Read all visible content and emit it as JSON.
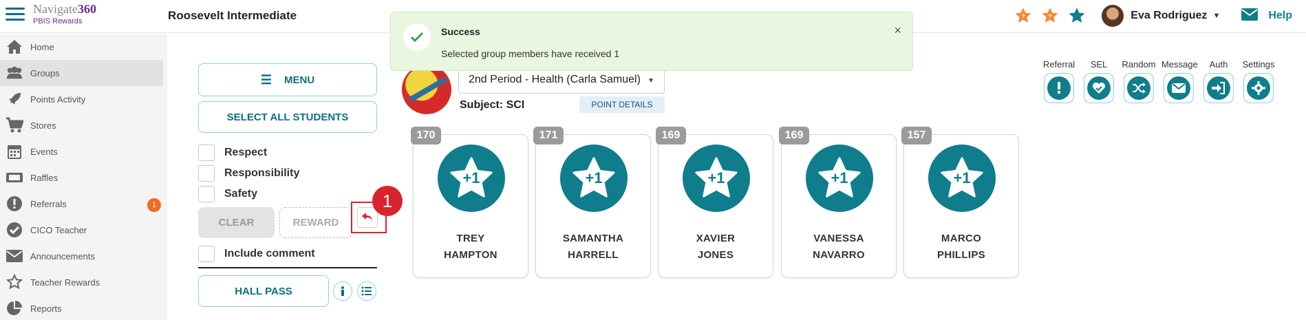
{
  "header": {
    "logo_main": "Navigate",
    "logo_num": "360",
    "logo_sub": "PBIS Rewards",
    "school": "Roosevelt Intermediate",
    "user_name": "Eva Rodriguez",
    "help_label": "Help"
  },
  "sidebar": {
    "items": [
      {
        "label": "Home",
        "icon": "home-icon"
      },
      {
        "label": "Groups",
        "icon": "groups-icon"
      },
      {
        "label": "Points Activity",
        "icon": "rocket-icon"
      },
      {
        "label": "Stores",
        "icon": "cart-icon"
      },
      {
        "label": "Events",
        "icon": "calendar-icon"
      },
      {
        "label": "Raffles",
        "icon": "ticket-icon"
      },
      {
        "label": "Referrals",
        "icon": "alert-icon",
        "badge": "1"
      },
      {
        "label": "CICO Teacher",
        "icon": "check-circle-icon"
      },
      {
        "label": "Announcements",
        "icon": "mail-icon"
      },
      {
        "label": "Teacher Rewards",
        "icon": "star-icon"
      },
      {
        "label": "Reports",
        "icon": "pie-chart-icon"
      }
    ]
  },
  "controls": {
    "menu_label": "MENU",
    "select_all_label": "SELECT ALL STUDENTS",
    "behaviors": [
      "Respect",
      "Responsibility",
      "Safety"
    ],
    "clear_label": "CLEAR",
    "reward_label": "REWARD",
    "include_comment_label": "Include comment",
    "hall_pass_label": "HALL PASS",
    "step_number": "1"
  },
  "group": {
    "selected": "2nd Period - Health (Carla Samuel)",
    "subject_label": "Subject:",
    "subject_value": "SCI",
    "point_details_label": "POINT DETAILS"
  },
  "toast": {
    "title": "Success",
    "message": "Selected group members have received 1",
    "close": "×"
  },
  "tools": [
    "Referral",
    "SEL",
    "Random",
    "Message",
    "Auth",
    "Settings"
  ],
  "award_label": "+1",
  "students": [
    {
      "points": "170",
      "first": "TREY",
      "last": "HAMPTON"
    },
    {
      "points": "171",
      "first": "SAMANTHA",
      "last": "HARRELL"
    },
    {
      "points": "169",
      "first": "XAVIER",
      "last": "JONES"
    },
    {
      "points": "169",
      "first": "VANESSA",
      "last": "NAVARRO"
    },
    {
      "points": "157",
      "first": "MARCO",
      "last": "PHILLIPS"
    }
  ],
  "colors": {
    "teal": "#0f7d8c",
    "orange": "#f26b21",
    "red": "#d9232d",
    "purple": "#6b2c91"
  }
}
